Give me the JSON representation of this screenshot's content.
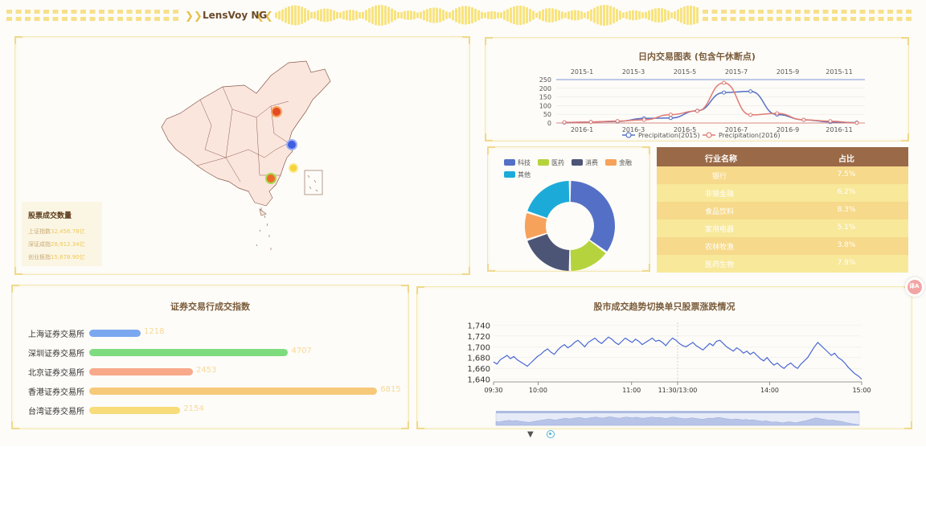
{
  "header": {
    "title": "LensVoy NG"
  },
  "map_panel": {
    "stats_title": "股票成交数量",
    "stats": [
      {
        "label": "上证指数",
        "value": "32,456.78亿"
      },
      {
        "label": "深证成指",
        "value": "28,912.34亿"
      },
      {
        "label": "创业板指",
        "value": "15,678.90亿"
      }
    ]
  },
  "intraday_chart": {
    "chart_data": {
      "type": "line",
      "title": "日内交易图表 (包含午休断点)",
      "top_axis_labels": [
        "2015-1",
        "2015-3",
        "2015-5",
        "2015-7",
        "2015-9",
        "2015-11"
      ],
      "bottom_axis_labels": [
        "2016-1",
        "2016-3",
        "2016-5",
        "2016-7",
        "2016-9",
        "2016-11"
      ],
      "y_ticks": [
        250,
        200,
        150,
        100,
        50,
        0
      ],
      "ylim": [
        0,
        250
      ],
      "series": [
        {
          "name": "Precipitation(2015)",
          "color": "#5470c6",
          "values": [
            2.6,
            5.9,
            9.0,
            26.4,
            28.7,
            70.7,
            175.6,
            182.2,
            48.7,
            18.8,
            6.0,
            2.3
          ]
        },
        {
          "name": "Precipitation(2016)",
          "color": "#e07b73",
          "values": [
            3.9,
            5.9,
            11.1,
            18.7,
            48.3,
            69.2,
            231.6,
            46.6,
            55.4,
            18.4,
            10.3,
            0.7
          ]
        }
      ]
    }
  },
  "donut_chart": {
    "chart_data": {
      "type": "pie",
      "categories": [
        "科技",
        "医药",
        "消费",
        "金融",
        "其他"
      ],
      "values": [
        35,
        15,
        20,
        10,
        20
      ],
      "colors": [
        "#5470c6",
        "#b5d33d",
        "#4d5577",
        "#f7a25a",
        "#1cabd9"
      ]
    }
  },
  "industry_table": {
    "headers": [
      "行业名称",
      "占比"
    ],
    "rows": [
      [
        "银行",
        "7.5%"
      ],
      [
        "非银金融",
        "6.2%"
      ],
      [
        "食品饮料",
        "8.3%"
      ],
      [
        "家用电器",
        "5.1%"
      ],
      [
        "农林牧渔",
        "3.8%"
      ],
      [
        "医药生物",
        "7.9%"
      ]
    ]
  },
  "exchange_chart": {
    "chart_data": {
      "type": "bar",
      "title": "证券交易行成交指数",
      "categories": [
        "上海证券交易所",
        "深圳证券交易所",
        "北京证券交易所",
        "香港证券交易所",
        "台湾证券交易所"
      ],
      "values": [
        1218,
        4707,
        2453,
        6815,
        2154
      ],
      "colors": [
        "#7ba7f0",
        "#7fdc7e",
        "#f7a98a",
        "#f7c97a",
        "#f9dc7a"
      ],
      "xlim": [
        0,
        7000
      ]
    }
  },
  "trend_chart": {
    "chart_data": {
      "type": "line",
      "title": "股市成交趋势切换单只股票涨跌情况",
      "x_ticks": [
        "09:30",
        "10:00",
        "11:00",
        "11:30/13:00",
        "14:00",
        "15:00"
      ],
      "y_ticks": [
        "1,740",
        "1,720",
        "1,700",
        "1,680",
        "1,660",
        "1,640"
      ],
      "ylim": [
        1635,
        1745
      ],
      "values": [
        1672,
        1668,
        1676,
        1680,
        1684,
        1678,
        1682,
        1676,
        1672,
        1668,
        1664,
        1670,
        1676,
        1682,
        1686,
        1692,
        1696,
        1690,
        1686,
        1694,
        1700,
        1704,
        1698,
        1702,
        1708,
        1712,
        1706,
        1700,
        1708,
        1712,
        1716,
        1710,
        1706,
        1712,
        1718,
        1714,
        1708,
        1704,
        1710,
        1716,
        1712,
        1708,
        1714,
        1710,
        1704,
        1708,
        1712,
        1716,
        1710,
        1712,
        1708,
        1702,
        1710,
        1716,
        1712,
        1706,
        1702,
        1700,
        1704,
        1708,
        1702,
        1698,
        1694,
        1700,
        1706,
        1702,
        1710,
        1712,
        1706,
        1700,
        1696,
        1692,
        1698,
        1694,
        1688,
        1692,
        1686,
        1690,
        1684,
        1678,
        1674,
        1680,
        1672,
        1666,
        1670,
        1664,
        1660,
        1666,
        1670,
        1664,
        1660,
        1668,
        1674,
        1680,
        1690,
        1700,
        1708,
        1702,
        1696,
        1690,
        1684,
        1688,
        1680,
        1676,
        1670,
        1662,
        1656,
        1650,
        1646,
        1640
      ]
    }
  },
  "floating": {
    "translate_label": "译A"
  }
}
